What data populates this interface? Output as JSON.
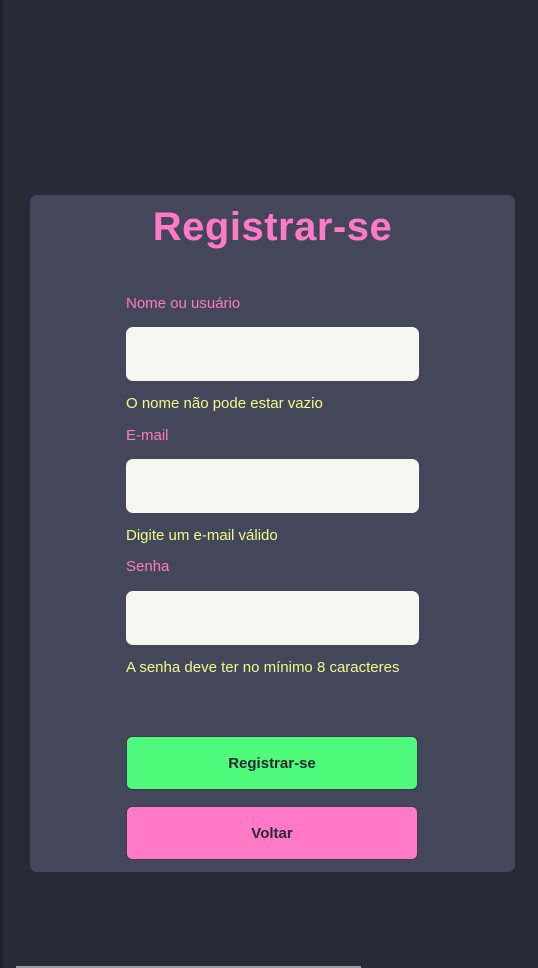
{
  "page": {
    "title": "Registrar-se"
  },
  "form": {
    "fields": [
      {
        "label": "Nome ou usuário",
        "value": "",
        "placeholder": "",
        "hint": "O nome não pode estar vazio"
      },
      {
        "label": "E-mail",
        "value": "",
        "placeholder": "",
        "hint": "Digite um e-mail válido"
      },
      {
        "label": "Senha",
        "value": "",
        "placeholder": "",
        "hint": "A senha deve ter no mínimo 8 caracteres"
      }
    ],
    "submit_label": "Registrar-se",
    "back_label": "Voltar"
  },
  "colors": {
    "background": "#282a36",
    "card": "#44475a",
    "accent_pink": "#ff79c6",
    "hint_yellow": "#f1fa8c",
    "button_green": "#50fa7b",
    "input_bg": "#f6f7f1"
  }
}
